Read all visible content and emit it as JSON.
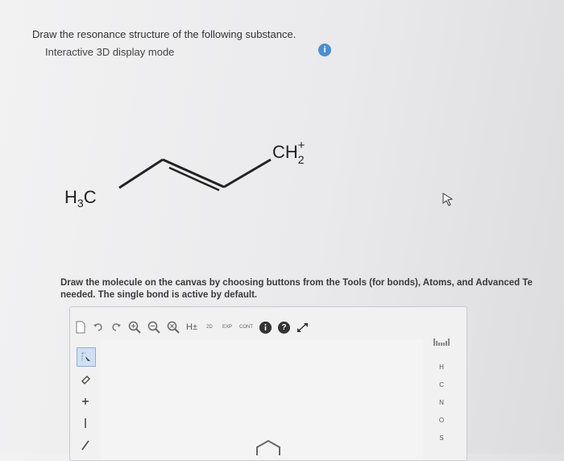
{
  "question": {
    "prompt": "Draw the resonance structure of the following substance.",
    "mode": "Interactive 3D display mode",
    "info_icon": "i"
  },
  "molecule": {
    "left_group": "H3C",
    "right_group": "CH2+",
    "bonds": [
      "single",
      "double",
      "single"
    ]
  },
  "instructions": {
    "line1": "Draw the molecule on the canvas by choosing buttons from the Tools (for bonds), Atoms, and Advanced Te",
    "line2": "needed. The single bond is active by default."
  },
  "editor": {
    "toolbar": {
      "h_label": "H±",
      "t2d_label": "2D",
      "exp_label": "EXP",
      "cont_label": "CONT",
      "help_label": "?"
    },
    "left_tools": [
      "select-arrow",
      "eraser",
      "charge-plus",
      "single-bond",
      "double-bond"
    ],
    "atoms": [
      "H",
      "C",
      "N",
      "O",
      "S"
    ]
  },
  "colors": {
    "info_badge": "#4a8fd6",
    "active_tool": "#cfe0f4"
  }
}
